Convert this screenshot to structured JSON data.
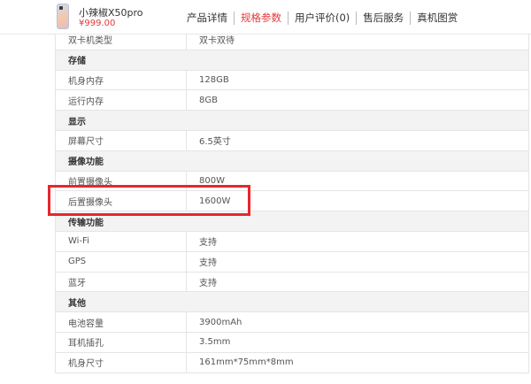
{
  "product": {
    "name": "小辣椒X50pro",
    "price": "¥999.00"
  },
  "nav": {
    "tabs": [
      {
        "label": "产品详情",
        "active": false
      },
      {
        "label": "规格参数",
        "active": true
      },
      {
        "label": "用户评价(0)",
        "active": false
      },
      {
        "label": "售后服务",
        "active": false
      },
      {
        "label": "真机图赏",
        "active": false
      }
    ]
  },
  "colors": {
    "accent": "#e4393c",
    "highlight_box": "#e8262c",
    "section_bg": "#f3f3f3"
  },
  "specs": [
    {
      "type": "row",
      "key": "双卡机类型",
      "value": "双卡双待"
    },
    {
      "type": "section",
      "title": "存储"
    },
    {
      "type": "row",
      "key": "机身内存",
      "value": "128GB"
    },
    {
      "type": "row",
      "key": "运行内存",
      "value": "8GB"
    },
    {
      "type": "section",
      "title": "显示"
    },
    {
      "type": "row",
      "key": "屏幕尺寸",
      "value": "6.5英寸"
    },
    {
      "type": "section",
      "title": "摄像功能"
    },
    {
      "type": "row",
      "key": "前置摄像头",
      "value": "800W"
    },
    {
      "type": "row",
      "key": "后置摄像头",
      "value": "1600W"
    },
    {
      "type": "section",
      "title": "传输功能"
    },
    {
      "type": "row",
      "key": "Wi-Fi",
      "value": "支持"
    },
    {
      "type": "row",
      "key": "GPS",
      "value": "支持"
    },
    {
      "type": "row",
      "key": "蓝牙",
      "value": "支持"
    },
    {
      "type": "section",
      "title": "其他"
    },
    {
      "type": "row",
      "key": "电池容量",
      "value": "3900mAh"
    },
    {
      "type": "row",
      "key": "耳机插孔",
      "value": "3.5mm"
    },
    {
      "type": "row",
      "key": "机身尺寸",
      "value": "161mm*75mm*8mm"
    }
  ]
}
